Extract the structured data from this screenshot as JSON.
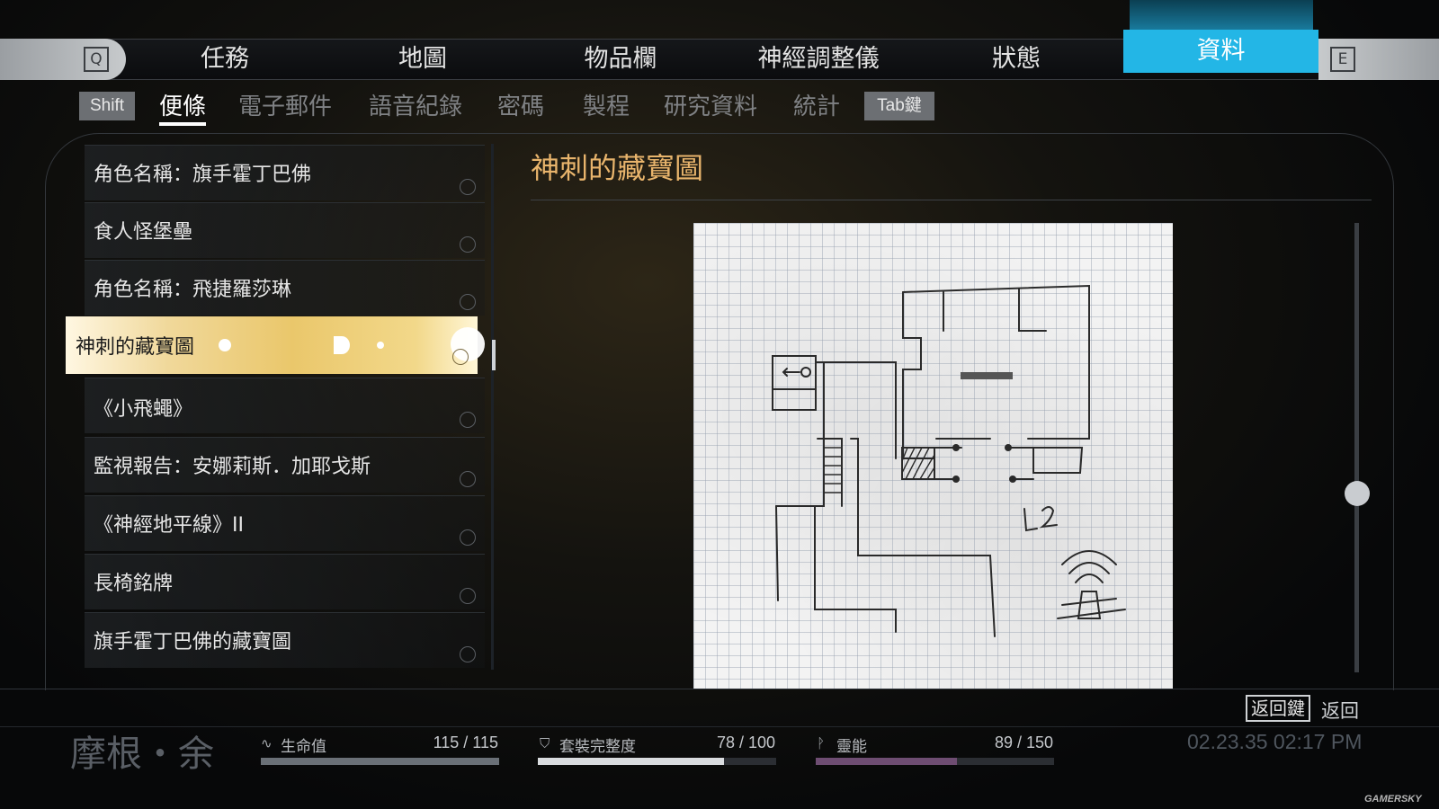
{
  "top_tabs": {
    "left_key": "Q",
    "right_key": "E",
    "items": [
      "任務",
      "地圖",
      "物品欄",
      "神經調整儀",
      "狀態",
      "資料"
    ],
    "active": "資料"
  },
  "sub_tabs": {
    "left_key": "Shift",
    "right_key": "Tab鍵",
    "items": [
      "便條",
      "電子郵件",
      "語音紀錄",
      "密碼",
      "製程",
      "研究資料",
      "統計"
    ],
    "active": "便條"
  },
  "notes_list": [
    "角色名稱：旗手霍丁巴佛",
    "食人怪堡壘",
    "角色名稱：飛捷羅莎琳",
    "神刺的藏寶圖",
    "《小飛蠅》",
    "監視報告：安娜莉斯．加耶戈斯",
    "《神經地平線》II",
    "長椅銘牌",
    "旗手霍丁巴佛的藏寶圖"
  ],
  "selected_note": "神刺的藏寶圖",
  "document": {
    "title": "神刺的藏寶圖",
    "map_annotation": "L2"
  },
  "back": {
    "key": "返回鍵",
    "label": "返回"
  },
  "status_bar": {
    "character_name": "摩根・余",
    "stats": [
      {
        "icon": "heartbeat-icon",
        "label": "生命值",
        "current": 115,
        "max": 115,
        "text": "115 / 115",
        "color": "#6a7077"
      },
      {
        "icon": "shield-icon",
        "label": "套裝完整度",
        "current": 78,
        "max": 100,
        "text": "78 / 100",
        "color": "#d9dcdf"
      },
      {
        "icon": "psi-icon",
        "label": "靈能",
        "current": 89,
        "max": 150,
        "text": "89 / 150",
        "color": "#6e4d72"
      }
    ],
    "datetime": "02.23.35 02:17 PM"
  },
  "colors": {
    "accent_tab": "#23b6e6",
    "title_gold": "#e8b46c",
    "selected_item": "#eac76b"
  },
  "watermark": "GAMERSKY"
}
